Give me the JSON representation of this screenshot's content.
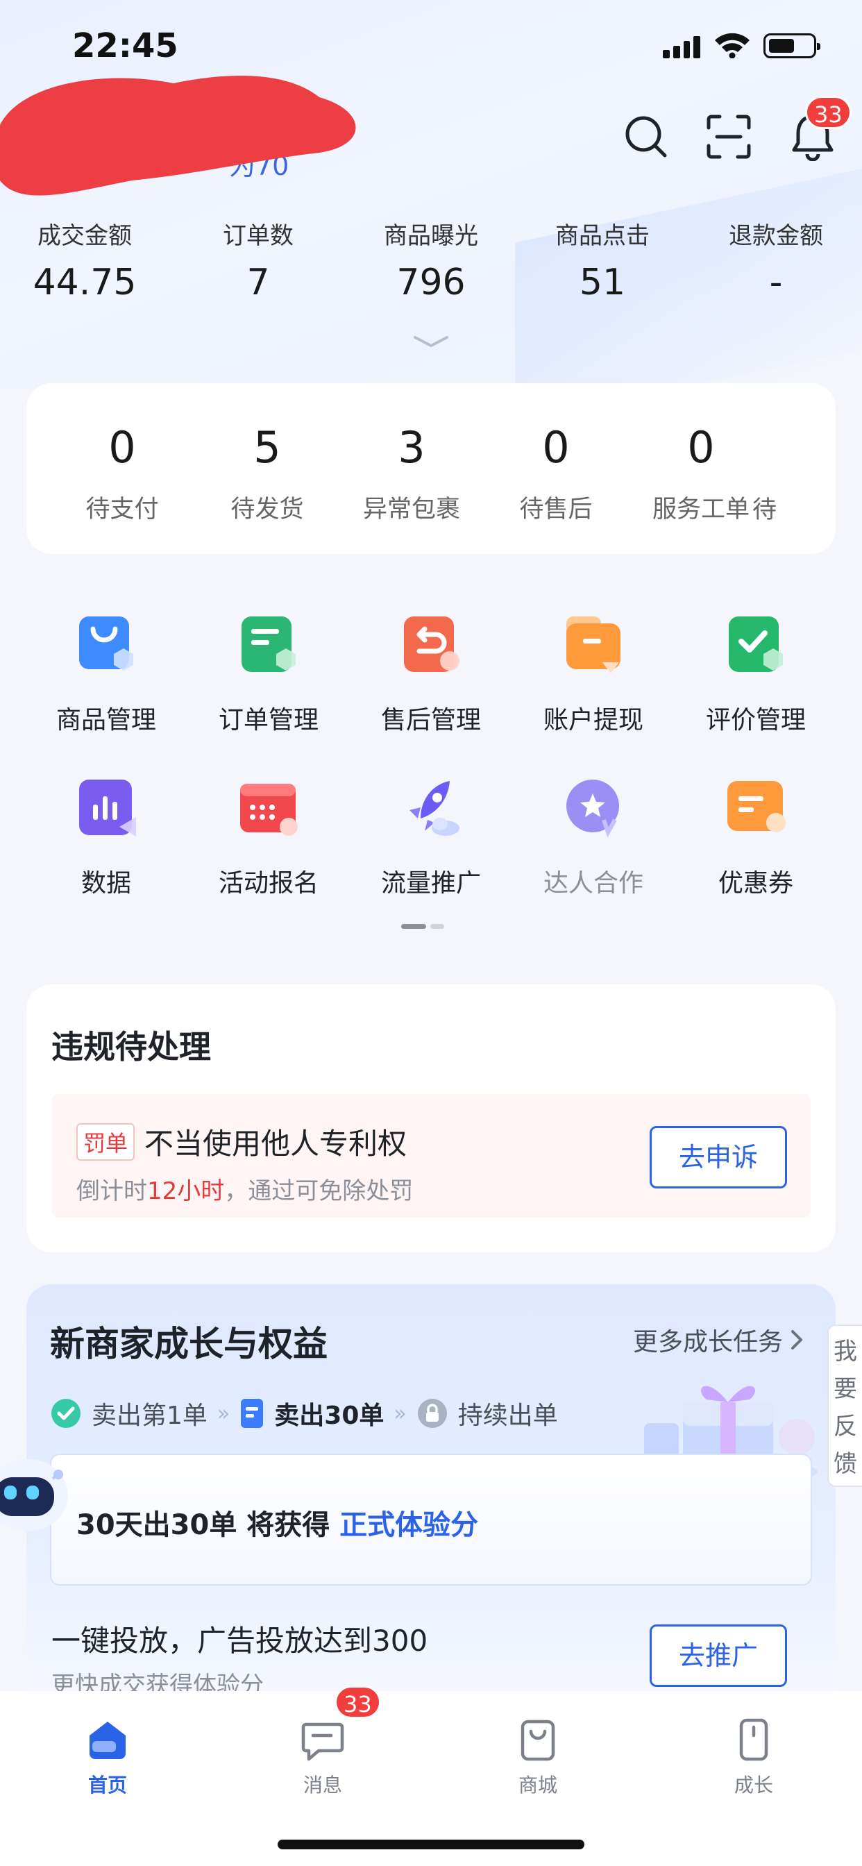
{
  "status_bar": {
    "time": "22:45"
  },
  "header": {
    "shop_sub": "为70",
    "notification_count": "33"
  },
  "stats": [
    {
      "label": "成交金额",
      "value": "44.75"
    },
    {
      "label": "订单数",
      "value": "7"
    },
    {
      "label": "商品曝光",
      "value": "796"
    },
    {
      "label": "商品点击",
      "value": "51"
    },
    {
      "label": "退款金额",
      "value": "-"
    }
  ],
  "orders": [
    {
      "count": "0",
      "label": "待支付"
    },
    {
      "count": "5",
      "label": "待发货"
    },
    {
      "count": "3",
      "label": "异常包裹"
    },
    {
      "count": "0",
      "label": "待售后"
    },
    {
      "count": "0",
      "label": "服务工单"
    },
    {
      "count": "",
      "label": "待"
    }
  ],
  "grid": [
    {
      "label": "商品管理",
      "icon": "goods-bag-icon",
      "color": "#3d8bff"
    },
    {
      "label": "订单管理",
      "icon": "order-list-icon",
      "color": "#2bb673"
    },
    {
      "label": "售后管理",
      "icon": "return-icon",
      "color": "#f2694e"
    },
    {
      "label": "账户提现",
      "icon": "wallet-icon",
      "color": "#ff9a3c"
    },
    {
      "label": "评价管理",
      "icon": "review-check-icon",
      "color": "#25b86a"
    },
    {
      "label": "数据",
      "icon": "bar-chart-icon",
      "color": "#7a5cf0"
    },
    {
      "label": "活动报名",
      "icon": "calendar-icon",
      "color": "#f0484c"
    },
    {
      "label": "流量推广",
      "icon": "rocket-icon",
      "color": "#6b5cf5"
    },
    {
      "label": "达人合作",
      "icon": "star-badge-icon",
      "color": "#9b8ef5"
    },
    {
      "label": "优惠券",
      "icon": "coupon-icon",
      "color": "#ff9a3c"
    }
  ],
  "violation": {
    "title": "违规待处理",
    "tag": "罚单",
    "headline": "不当使用他人专利权",
    "countdown_prefix": "倒计时",
    "countdown_value": "12小时",
    "countdown_suffix": "，通过可免除处罚",
    "action": "去申诉"
  },
  "growth": {
    "title": "新商家成长与权益",
    "more": "更多成长任务",
    "steps": [
      "卖出第1单",
      "卖出30单",
      "持续出单"
    ],
    "goal_prefix": "30天出30单 将获得 ",
    "goal_highlight": "正式体验分",
    "task_title": "一键投放，广告投放达到300",
    "task_sub": "更快成交获得体验分",
    "task_action": "去推广"
  },
  "feedback": "我要反馈",
  "nav": [
    {
      "label": "首页",
      "active": true
    },
    {
      "label": "消息",
      "badge": "33"
    },
    {
      "label": "商城"
    },
    {
      "label": "成长"
    }
  ],
  "colors": {
    "accent": "#2b63e6",
    "badge": "#f23d3d",
    "penalty": "#e53a3a"
  }
}
